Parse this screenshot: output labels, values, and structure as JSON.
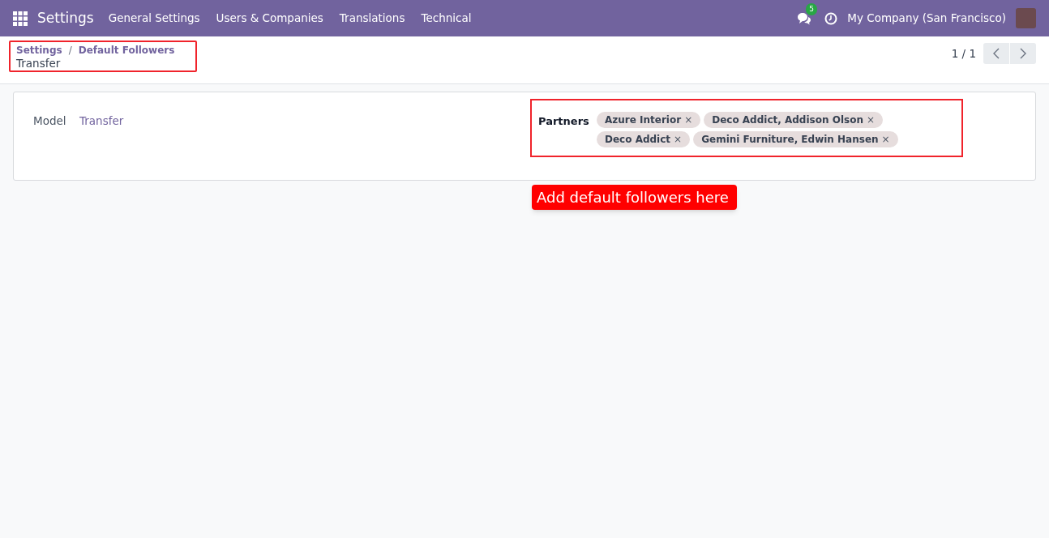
{
  "navbar": {
    "app_name": "Settings",
    "menu": [
      "General Settings",
      "Users & Companies",
      "Translations",
      "Technical"
    ],
    "messages_count": "5",
    "company": "My Company (San Francisco)"
  },
  "breadcrumb": {
    "items": [
      "Settings",
      "Default Followers"
    ],
    "separator": "/",
    "current": "Transfer"
  },
  "pager": {
    "value": "1 / 1"
  },
  "form": {
    "model_label": "Model",
    "model_value": "Transfer",
    "partners_label": "Partners",
    "partners": [
      {
        "label": "Azure Interior",
        "remove": "×"
      },
      {
        "label": "Deco Addict, Addison Olson",
        "remove": "×"
      },
      {
        "label": "Deco Addict",
        "remove": "×"
      },
      {
        "label": "Gemini Furniture, Edwin Hansen",
        "remove": "×"
      }
    ]
  },
  "callout": "Add default followers here"
}
